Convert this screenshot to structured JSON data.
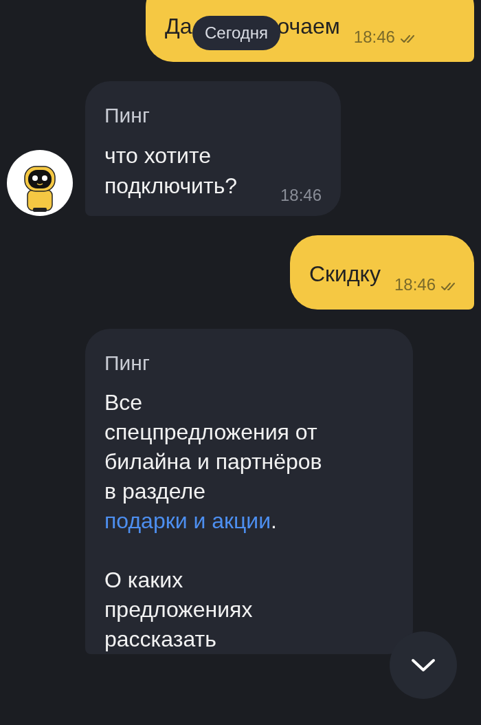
{
  "date_badge": "Сегодня",
  "messages": [
    {
      "kind": "outgoing",
      "text_parts": [
        "Да",
        "очаем"
      ],
      "time": "18:46",
      "read": true
    },
    {
      "kind": "incoming",
      "sender": "Пинг",
      "avatar": true,
      "text": "что хотите подключить?",
      "time": "18:46"
    },
    {
      "kind": "outgoing",
      "text_parts": [
        "Скидку"
      ],
      "time": "18:46",
      "read": true
    },
    {
      "kind": "incoming_long",
      "sender": "Пинг",
      "avatar": false,
      "paragraphs": [
        [
          {
            "text": "Все спецпредложения от билайна и партнёров в разделе ",
            "kind": "plain"
          },
          {
            "text": "подарки и акции",
            "kind": "link"
          },
          {
            "text": ".",
            "kind": "plain"
          }
        ],
        [
          {
            "text": "О каких предложениях рассказать",
            "kind": "plain"
          }
        ]
      ]
    }
  ]
}
